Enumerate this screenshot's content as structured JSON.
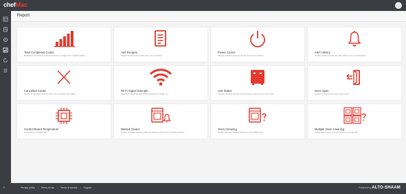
{
  "app": {
    "logo_part1": "chef",
    "logo_part2": "Mac",
    "page_title": "Report"
  },
  "sidebar": {
    "items": [
      {
        "icon": "dashboard-icon"
      },
      {
        "icon": "document-icon"
      },
      {
        "icon": "settings-icon"
      },
      {
        "icon": "report-icon"
      },
      {
        "icon": "refresh-icon"
      },
      {
        "icon": "list-icon"
      }
    ]
  },
  "cards": [
    {
      "title": "Total Completed Cooks",
      "desc": "Breakdown of number of cooks for recipes for a single unit or single locations",
      "icon": "bar-chart-icon"
    },
    {
      "title": "Unit Recipes",
      "desc": "Number of recipes per unit for one or more locations",
      "icon": "recipe-document-icon"
    },
    {
      "title": "Power Cycles",
      "desc": "Number of power cycles per unit for one or more locations",
      "icon": "power-icon"
    },
    {
      "title": "Alert History",
      "desc": "Number of alerts and last per alert code for one or more locations",
      "icon": "bell-icon"
    },
    {
      "title": "Cancelled Cooks",
      "desc": "Number of cancelled cooks for one or more locations and recipes",
      "icon": "x-icon"
    },
    {
      "title": "Wi-Fi Signal Strength",
      "desc": "Daily Wi-Fi Signal Strength (RSSI) reported by a single unit",
      "icon": "wifi-icon"
    },
    {
      "title": "Unit Status",
      "desc": "Location, firmware versions, and connection state of one or more units",
      "icon": "unit-status-icon"
    },
    {
      "title": "Door Open",
      "desc": "Number of times an oven door was opened",
      "icon": "door-open-icon"
    },
    {
      "title": "Control Board Temperature",
      "desc": "Temperature of control board",
      "icon": "chip-icon"
    },
    {
      "title": "Missed Cleans",
      "desc": "Number of missed cleaning cycles per cleaning type for one or multiple locations",
      "icon": "oven-alert-icon"
    },
    {
      "title": "Oven Cleaning",
      "desc": "Number and type of cleans performed in an multiple days",
      "icon": "oven-question-icon"
    },
    {
      "title": "Multiple Oven Cleaning",
      "desc": "Cleans performed on a group of ovens on a single day",
      "icon": "multi-oven-icon"
    }
  ],
  "footer": {
    "links": [
      "Privacy policy",
      "Terms of use",
      "Terms of service",
      "Support"
    ],
    "powered_by": "Powered by",
    "brand": "ALTO-SHAAM"
  },
  "colors": {
    "accent": "#e23a2e",
    "chrome": "#3a3d42",
    "background": "#f4f4f4"
  }
}
